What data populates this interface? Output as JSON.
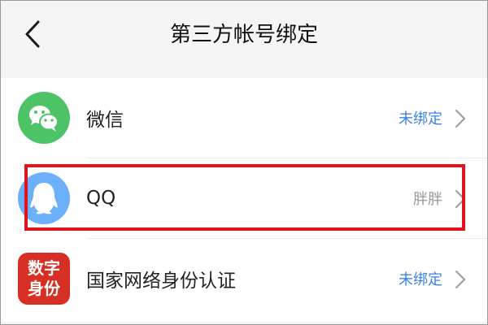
{
  "header": {
    "back_icon": "chevron-left-icon",
    "title": "第三方帐号绑定"
  },
  "accounts": [
    {
      "name": "微信",
      "status": "未绑定",
      "status_color": "#3b83e0",
      "icon": "wechat-icon",
      "icon_color": "#4dc368"
    },
    {
      "name": "QQ",
      "status": "胖胖",
      "status_color": "#9a9a9a",
      "icon": "qq-icon",
      "icon_color": "#6cb0fb"
    },
    {
      "name": "国家网络身份认证",
      "status": "未绑定",
      "status_color": "#3b83e0",
      "icon": "digital-id-icon",
      "icon_color": "#d62f24",
      "icon_text": [
        "数字",
        "身份"
      ]
    }
  ],
  "highlight_color": "#e0141e"
}
